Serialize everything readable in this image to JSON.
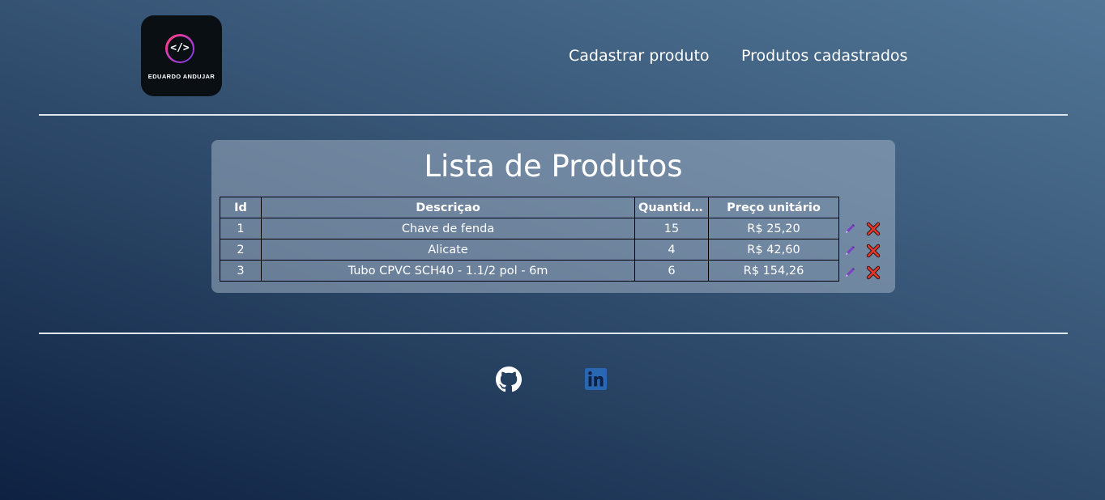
{
  "header": {
    "logo": {
      "symbol": "</>",
      "name": "EDUARDO ANDUJAR"
    },
    "nav": [
      {
        "label": "Cadastrar produto"
      },
      {
        "label": "Produtos cadastrados"
      }
    ]
  },
  "main": {
    "title": "Lista de Produtos",
    "table": {
      "columns": [
        "Id",
        "Descriçao",
        "Quantida...",
        "Preço unitário"
      ],
      "rows": [
        {
          "id": "1",
          "descricao": "Chave de fenda",
          "quantidade": "15",
          "preco": "R$ 25,20"
        },
        {
          "id": "2",
          "descricao": "Alicate",
          "quantidade": "4",
          "preco": "R$ 42,60"
        },
        {
          "id": "3",
          "descricao": "Tubo CPVC SCH40 - 1.1/2 pol - 6m",
          "quantidade": "6",
          "preco": "R$ 154,26"
        }
      ],
      "row_actions": {
        "edit_icon": "pencil-icon",
        "delete_icon": "x-mark-icon"
      }
    }
  },
  "footer": {
    "links": [
      {
        "icon": "github-icon"
      },
      {
        "icon": "linkedin-icon"
      }
    ]
  },
  "colors": {
    "background_top": "#517696",
    "background_bottom": "#0e2142",
    "card": "#7f93aa",
    "linkedin": "#2867b2",
    "delete": "#e8352b",
    "edit": "#7b3fc4"
  }
}
